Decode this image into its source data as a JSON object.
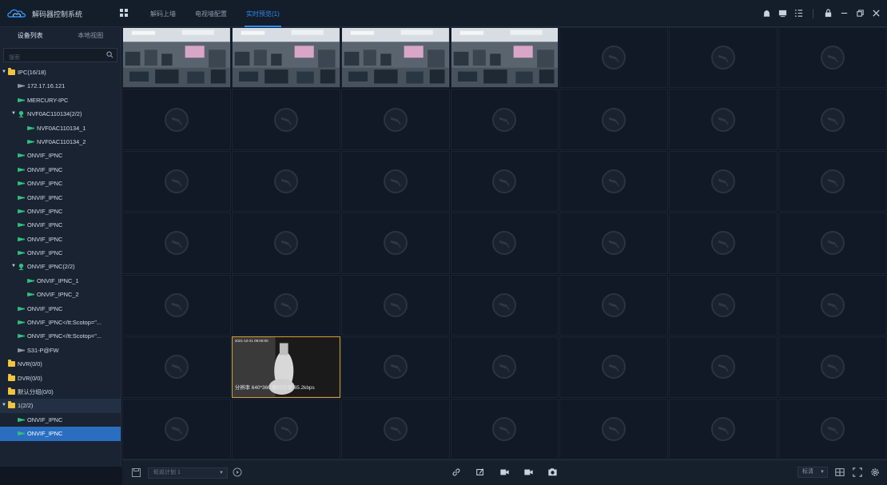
{
  "app": {
    "title": "解码器控制系统",
    "colors": {
      "accent": "#2f8cf0",
      "folder": "#f2c43d",
      "online": "#2ec27e",
      "selection": "#2a6ec0",
      "active_border": "#d6a033"
    }
  },
  "header": {
    "tabs": [
      {
        "label": "解码上墙",
        "active": false
      },
      {
        "label": "电视墙配置",
        "active": false
      },
      {
        "label": "实时预览(1)",
        "active": true
      }
    ],
    "right_icons": [
      "alarm-icon",
      "screen-icon",
      "list-icon",
      "lock-icon",
      "minimize-icon",
      "restore-icon",
      "close-icon"
    ]
  },
  "sidebar": {
    "tabs": [
      {
        "label": "设备列表",
        "active": true
      },
      {
        "label": "本地视图",
        "active": false
      }
    ],
    "search": {
      "placeholder": "搜索",
      "value": ""
    },
    "tree": [
      {
        "label": "IPC(16/18)",
        "type": "folder",
        "level": 0,
        "expanded": true
      },
      {
        "label": "172.17.16.121",
        "type": "camera",
        "level": 1,
        "online": false
      },
      {
        "label": "MERCURY-IPC",
        "type": "camera",
        "level": 1,
        "online": true
      },
      {
        "label": "NVF0AC110134(2/2)",
        "type": "group",
        "level": 1,
        "expanded": true
      },
      {
        "label": "NVF0AC110134_1",
        "type": "camera",
        "level": 2,
        "online": true
      },
      {
        "label": "NVF0AC110134_2",
        "type": "camera",
        "level": 2,
        "online": true
      },
      {
        "label": "ONVIF_IPNC",
        "type": "camera",
        "level": 1,
        "online": true
      },
      {
        "label": "ONVIF_IPNC",
        "type": "camera",
        "level": 1,
        "online": true
      },
      {
        "label": "ONVIF_IPNC",
        "type": "camera",
        "level": 1,
        "online": true
      },
      {
        "label": "ONVIF_IPNC",
        "type": "camera",
        "level": 1,
        "online": true
      },
      {
        "label": "ONVIF_IPNC",
        "type": "camera",
        "level": 1,
        "online": true
      },
      {
        "label": "ONVIF_IPNC",
        "type": "camera",
        "level": 1,
        "online": true
      },
      {
        "label": "ONVIF_IPNC",
        "type": "camera",
        "level": 1,
        "online": true
      },
      {
        "label": "ONVIF_IPNC",
        "type": "camera",
        "level": 1,
        "online": true
      },
      {
        "label": "ONVIF_IPNC(2/2)",
        "type": "group",
        "level": 1,
        "expanded": true
      },
      {
        "label": "ONVIF_IPNC_1",
        "type": "camera",
        "level": 2,
        "online": true
      },
      {
        "label": "ONVIF_IPNC_2",
        "type": "camera",
        "level": 2,
        "online": true
      },
      {
        "label": "ONVIF_IPNC",
        "type": "camera",
        "level": 1,
        "online": true
      },
      {
        "label": "ONVIF_IPNC</tt:Scotop=\"...",
        "type": "camera",
        "level": 1,
        "online": true
      },
      {
        "label": "ONVIF_IPNC</tt:Scotop=\"...",
        "type": "camera",
        "level": 1,
        "online": true
      },
      {
        "label": "S31-P@FW",
        "type": "camera",
        "level": 1,
        "online": false
      },
      {
        "label": "NVR(0/0)",
        "type": "folder",
        "level": 0,
        "expanded": false
      },
      {
        "label": "DVR(0/0)",
        "type": "folder",
        "level": 0,
        "expanded": false
      },
      {
        "label": "默认分组(0/0)",
        "type": "folder",
        "level": 0,
        "expanded": false
      },
      {
        "label": "1(2/2)",
        "type": "folder",
        "level": 0,
        "expanded": true,
        "highlight": true
      },
      {
        "label": "ONVIF_IPNC",
        "type": "camera",
        "level": 1,
        "online": true
      },
      {
        "label": "ONVIF_IPNC",
        "type": "camera",
        "level": 1,
        "online": true,
        "selected": true
      }
    ]
  },
  "grid": {
    "columns": 7,
    "rows": 7,
    "feeds": [
      {
        "index": 0,
        "scene": "office",
        "timestamp": ""
      },
      {
        "index": 1,
        "scene": "office",
        "timestamp": ""
      },
      {
        "index": 2,
        "scene": "office",
        "timestamp": ""
      },
      {
        "index": 3,
        "scene": "office",
        "timestamp": ""
      },
      {
        "index": 36,
        "scene": "night",
        "timestamp": "2021-10-21 09:00:00",
        "selected": true,
        "caption": "分辨率 640*360   瞬时码率 65.2kbps"
      }
    ]
  },
  "footer": {
    "plan_select": {
      "value": "轮巡计划 1"
    },
    "center_tools": [
      "link-icon",
      "snapshot-edit-icon",
      "record-icon",
      "record-stop-icon",
      "capture-icon"
    ],
    "stream_select": {
      "value": "标清"
    },
    "right_tools": [
      "split-screen-icon",
      "fullscreen-icon",
      "settings-icon"
    ]
  }
}
